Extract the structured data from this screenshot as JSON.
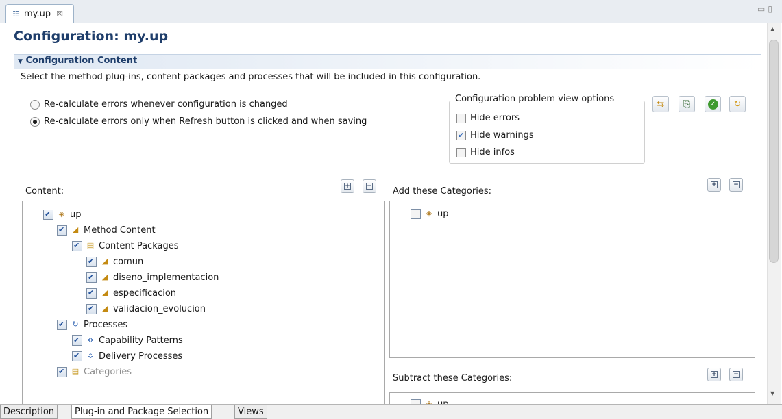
{
  "editor_tab": {
    "label": "my.up",
    "close": "☒"
  },
  "window_controls": {
    "minimize": "▭",
    "maximize": "▯"
  },
  "page_title": "Configuration: my.up",
  "section": {
    "title": "Configuration Content",
    "description": "Select the method plug-ins, content packages and processes that will be included in this configuration."
  },
  "radios": {
    "option1": "Re-calculate errors whenever configuration is changed",
    "option2": "Re-calculate errors only when Refresh button is clicked and when saving",
    "selected": "option2"
  },
  "problem_view": {
    "title": "Configuration problem view options",
    "hide_errors": {
      "label": "Hide errors",
      "checked": false
    },
    "hide_warnings": {
      "label": "Hide warnings",
      "checked": true
    },
    "hide_infos": {
      "label": "Hide infos",
      "checked": false
    }
  },
  "toolbar_icons": [
    "hide-problems-icon",
    "show-problems-icon",
    "validate-icon",
    "refresh-icon"
  ],
  "content_panel": {
    "label": "Content:",
    "tree": [
      {
        "label": "up",
        "level": 0,
        "icon": "plugin-icon",
        "checked": true
      },
      {
        "label": "Method Content",
        "level": 1,
        "icon": "method-content-icon",
        "checked": true
      },
      {
        "label": "Content Packages",
        "level": 2,
        "icon": "content-packages-icon",
        "checked": true
      },
      {
        "label": "comun",
        "level": 3,
        "icon": "content-package-icon",
        "checked": true
      },
      {
        "label": "diseno_implementacion",
        "level": 3,
        "icon": "content-package-icon",
        "checked": true
      },
      {
        "label": "especificacion",
        "level": 3,
        "icon": "content-package-icon",
        "checked": true
      },
      {
        "label": "validacion_evolucion",
        "level": 3,
        "icon": "content-package-icon",
        "checked": true
      },
      {
        "label": "Processes",
        "level": 1,
        "icon": "processes-icon",
        "checked": true
      },
      {
        "label": "Capability Patterns",
        "level": 2,
        "icon": "capability-patterns-icon",
        "checked": true
      },
      {
        "label": "Delivery Processes",
        "level": 2,
        "icon": "delivery-processes-icon",
        "checked": true
      },
      {
        "label": "Categories",
        "level": 1,
        "icon": "categories-icon",
        "checked": true,
        "greyed": true
      }
    ]
  },
  "add_panel": {
    "label": "Add these Categories:",
    "tree": [
      {
        "label": "up",
        "icon": "plugin-icon",
        "checked": false
      }
    ]
  },
  "subtract_panel": {
    "label": "Subtract these Categories:",
    "tree": [
      {
        "label": "up",
        "icon": "plugin-icon",
        "checked": false
      }
    ]
  },
  "bottom_tabs": [
    {
      "label": "Description",
      "active": false
    },
    {
      "label": "Plug-in and Package Selection",
      "active": true
    },
    {
      "label": "Views",
      "active": false
    }
  ]
}
